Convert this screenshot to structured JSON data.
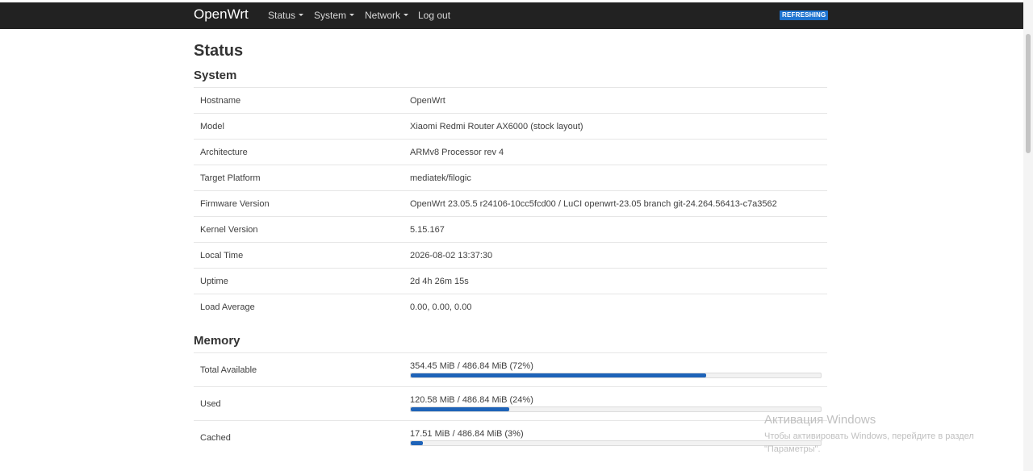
{
  "header": {
    "brand": "OpenWrt",
    "nav": [
      {
        "label": "Status",
        "has_caret": true
      },
      {
        "label": "System",
        "has_caret": true
      },
      {
        "label": "Network",
        "has_caret": true
      },
      {
        "label": "Log out",
        "has_caret": false
      }
    ],
    "indicator": "REFRESHING",
    "indicator_color": "#1e74d0",
    "bar_color": "#222222"
  },
  "page": {
    "title": "Status"
  },
  "system": {
    "title": "System",
    "rows": [
      {
        "label": "Hostname",
        "value": "OpenWrt"
      },
      {
        "label": "Model",
        "value": "Xiaomi Redmi Router AX6000 (stock layout)"
      },
      {
        "label": "Architecture",
        "value": "ARMv8 Processor rev 4"
      },
      {
        "label": "Target Platform",
        "value": "mediatek/filogic"
      },
      {
        "label": "Firmware Version",
        "value": "OpenWrt 23.05.5 r24106-10cc5fcd00 / LuCI openwrt-23.05 branch git-24.264.56413-c7a3562"
      },
      {
        "label": "Kernel Version",
        "value": "5.15.167"
      },
      {
        "label": "Local Time",
        "value": "2026-08-02 13:37:30"
      },
      {
        "label": "Uptime",
        "value": "2d 4h 26m 15s"
      },
      {
        "label": "Load Average",
        "value": "0.00, 0.00, 0.00"
      }
    ]
  },
  "memory": {
    "title": "Memory",
    "bar_color": "#1e63b8",
    "rows": [
      {
        "label": "Total Available",
        "value": "354.45 MiB / 486.84 MiB (72%)",
        "fraction": 0.72
      },
      {
        "label": "Used",
        "value": "120.58 MiB / 486.84 MiB (24%)",
        "fraction": 0.24
      },
      {
        "label": "Cached",
        "value": "17.51 MiB / 486.84 MiB (3%)",
        "fraction": 0.03
      }
    ]
  },
  "watermark": {
    "title": "Активация Windows",
    "subtitle_line1": "Чтобы активировать Windows, перейдите в раздел",
    "subtitle_line2": "\"Параметры\"."
  }
}
